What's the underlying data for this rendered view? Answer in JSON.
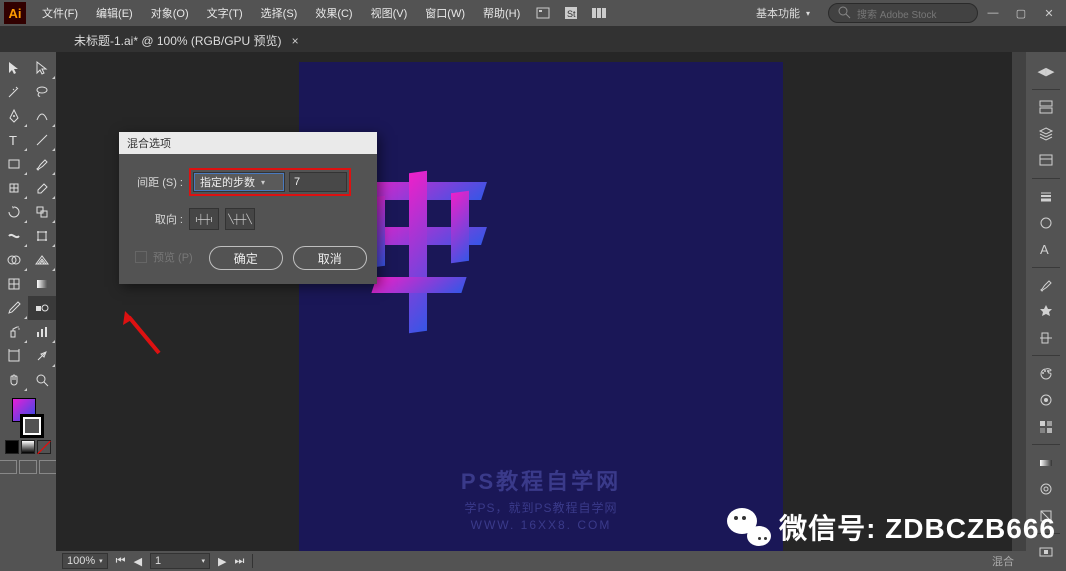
{
  "menu": {
    "file": "文件(F)",
    "edit": "编辑(E)",
    "object": "对象(O)",
    "type": "文字(T)",
    "select": "选择(S)",
    "effect": "效果(C)",
    "view": "视图(V)",
    "window": "窗口(W)",
    "help": "帮助(H)"
  },
  "workspace": "基本功能",
  "search_placeholder": "搜索 Adobe Stock",
  "tab": {
    "title": "未标题-1.ai* @ 100% (RGB/GPU 预览)"
  },
  "dialog": {
    "title": "混合选项",
    "spacing_label": "间距 (S) :",
    "spacing_option": "指定的步数",
    "spacing_value": "7",
    "orient_label": "取向 :",
    "preview_label": "预览 (P)",
    "ok": "确定",
    "cancel": "取消"
  },
  "watermark": {
    "l1": "PS教程自学网",
    "l2": "学PS，就到PS教程自学网",
    "l3": "WWW. 16XX8. COM"
  },
  "status": {
    "zoom": "100%",
    "blend": "混合"
  },
  "wechat": {
    "label": "微信号: ZDBCZB666"
  }
}
